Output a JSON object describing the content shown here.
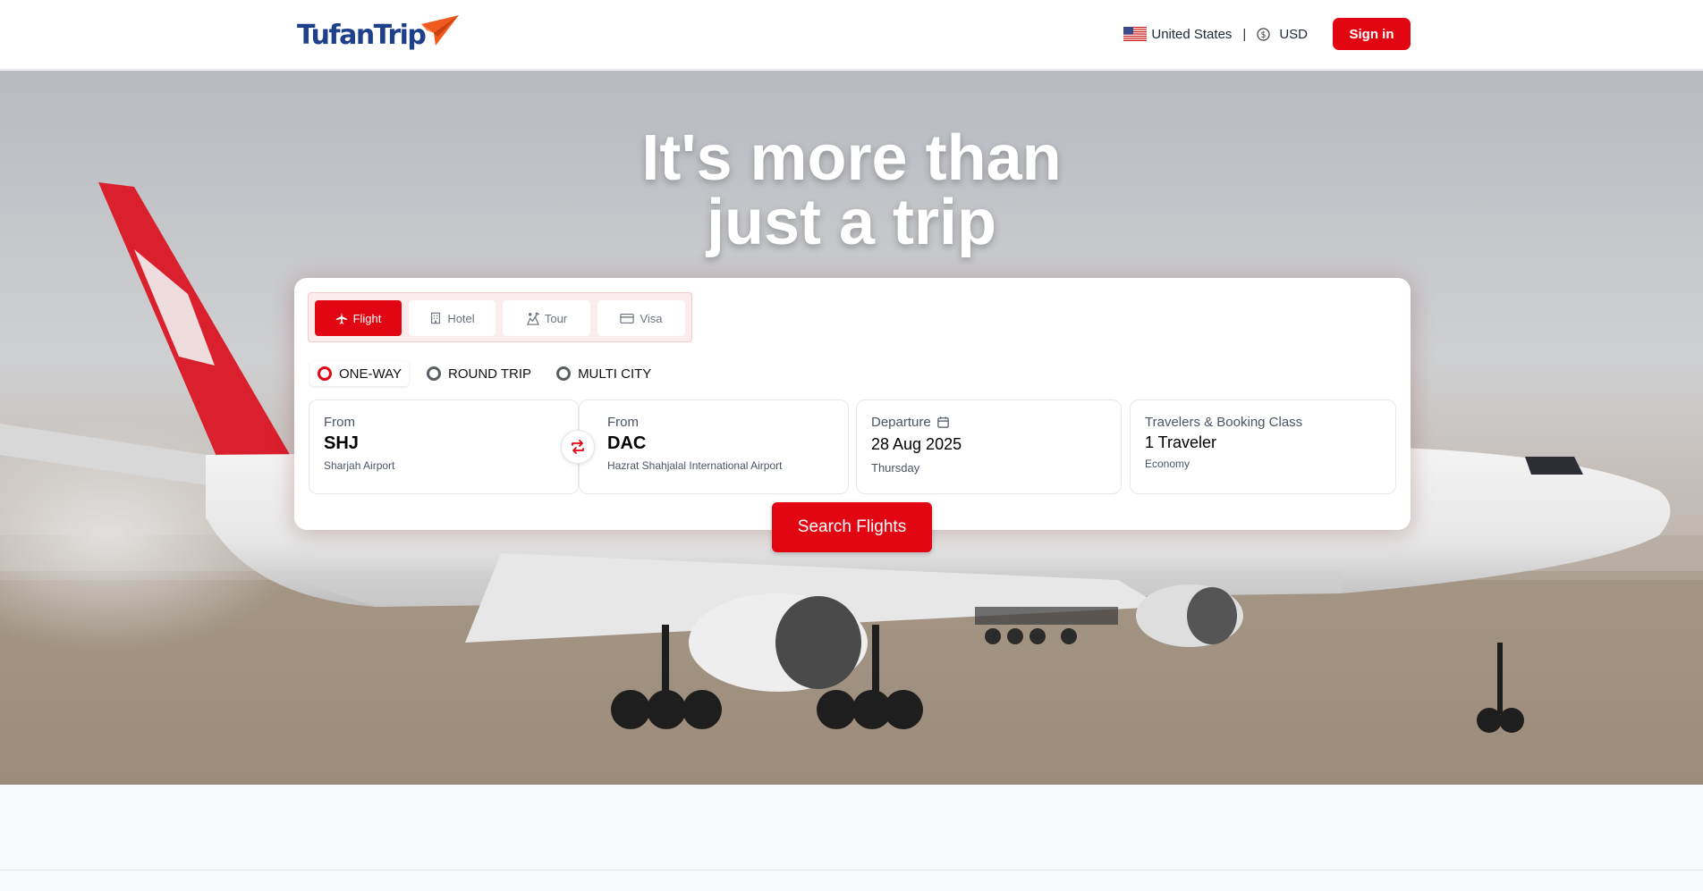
{
  "brand": {
    "name": "TufanTrip",
    "accent": "#e20613",
    "logo_color": "#1e3f8a"
  },
  "header": {
    "country": "United States",
    "separator": "|",
    "currency": "USD",
    "signin_label": "Sign in",
    "flag_icon": "us-flag-icon",
    "currency_icon": "dollar-circle-icon"
  },
  "hero": {
    "title_line1": "It's more than",
    "title_line2": "just a trip"
  },
  "search": {
    "tabs": [
      {
        "label": "Flight",
        "icon": "plane-icon",
        "active": true
      },
      {
        "label": "Hotel",
        "icon": "building-icon",
        "active": false
      },
      {
        "label": "Tour",
        "icon": "tour-icon",
        "active": false
      },
      {
        "label": "Visa",
        "icon": "card-icon",
        "active": false
      }
    ],
    "trip_types": [
      {
        "label": "ONE-WAY",
        "selected": true
      },
      {
        "label": "ROUND TRIP",
        "selected": false
      },
      {
        "label": "MULTI CITY",
        "selected": false
      }
    ],
    "from": {
      "label": "From",
      "code": "SHJ",
      "airport": "Sharjah Airport"
    },
    "to": {
      "label": "From",
      "code": "DAC",
      "airport": "Hazrat Shahjalal International Airport"
    },
    "departure": {
      "label": "Departure",
      "date": "28 Aug 2025",
      "day": "Thursday"
    },
    "travelers": {
      "label": "Travelers & Booking Class",
      "count": "1 Traveler",
      "class": "Economy"
    },
    "button_label": "Search Flights"
  }
}
